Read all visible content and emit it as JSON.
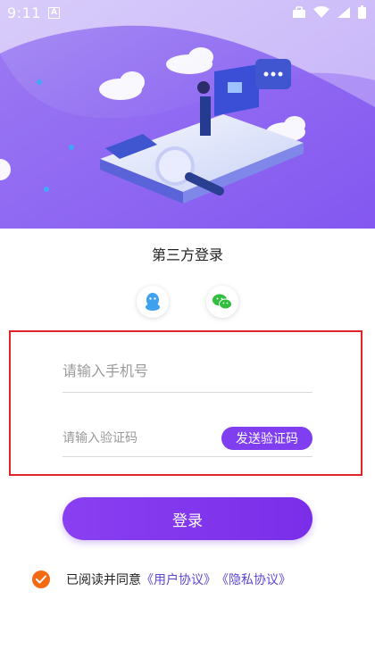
{
  "status_bar": {
    "time": "9:11",
    "a_indicator": "A",
    "icons": [
      "briefcase-icon",
      "wifi-icon",
      "signal-icon",
      "battery-icon"
    ]
  },
  "third_party": {
    "title": "第三方登录",
    "providers": [
      "qq-icon",
      "wechat-icon"
    ]
  },
  "form": {
    "phone_placeholder": "请输入手机号",
    "code_placeholder": "请输入验证码",
    "send_code_label": "发送验证码"
  },
  "login_label": "登录",
  "agreement": {
    "prefix": "已阅读并同意",
    "user_agreement": "《用户协议》",
    "privacy_agreement": "《隐私协议》",
    "checked": true
  },
  "colors": {
    "accent": "#7f3ff0",
    "check": "#f26a14",
    "highlight_border": "#e0242a",
    "link": "#5b48d0"
  }
}
